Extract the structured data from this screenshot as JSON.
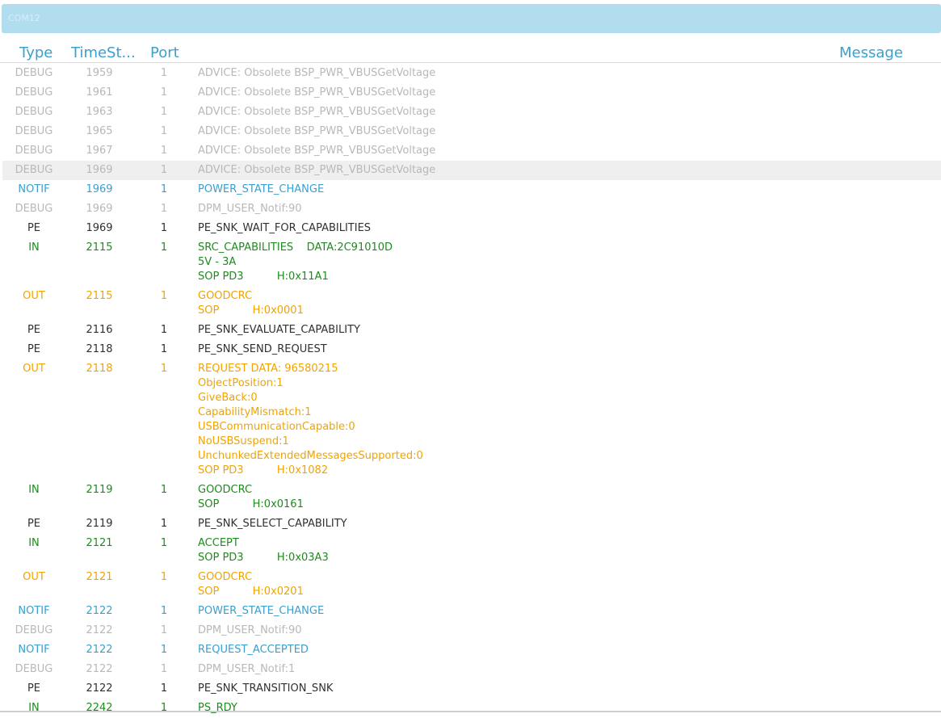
{
  "window": {
    "title": "COM12"
  },
  "columns": {
    "type": "Type",
    "timestamp": "TimeSt...",
    "port": "Port",
    "message": "Message"
  },
  "colors": {
    "DEBUG": "#b8b8b8",
    "NOTIF": "#3a9fcf",
    "PE": "#303030",
    "IN": "#1e8b1e",
    "OUT": "#f0a400"
  },
  "rows": [
    {
      "type": "DEBUG",
      "time": "1959",
      "port": "1",
      "message": [
        "ADVICE: Obsolete BSP_PWR_VBUSGetVoltage"
      ]
    },
    {
      "type": "DEBUG",
      "time": "1961",
      "port": "1",
      "message": [
        "ADVICE: Obsolete BSP_PWR_VBUSGetVoltage"
      ]
    },
    {
      "type": "DEBUG",
      "time": "1963",
      "port": "1",
      "message": [
        "ADVICE: Obsolete BSP_PWR_VBUSGetVoltage"
      ]
    },
    {
      "type": "DEBUG",
      "time": "1965",
      "port": "1",
      "message": [
        "ADVICE: Obsolete BSP_PWR_VBUSGetVoltage"
      ]
    },
    {
      "type": "DEBUG",
      "time": "1967",
      "port": "1",
      "message": [
        "ADVICE: Obsolete BSP_PWR_VBUSGetVoltage"
      ]
    },
    {
      "type": "DEBUG",
      "time": "1969",
      "port": "1",
      "message": [
        "ADVICE: Obsolete BSP_PWR_VBUSGetVoltage"
      ],
      "selected": true
    },
    {
      "type": "NOTIF",
      "time": "1969",
      "port": "1",
      "message": [
        "POWER_STATE_CHANGE"
      ]
    },
    {
      "type": "DEBUG",
      "time": "1969",
      "port": "1",
      "message": [
        "DPM_USER_Notif:90"
      ]
    },
    {
      "type": "PE",
      "time": "1969",
      "port": "1",
      "message": [
        "PE_SNK_WAIT_FOR_CAPABILITIES"
      ]
    },
    {
      "type": "IN",
      "time": "2115",
      "port": "1",
      "message": [
        "SRC_CAPABILITIES    DATA:2C91010D",
        "5V - 3A",
        "SOP PD3          H:0x11A1"
      ]
    },
    {
      "type": "OUT",
      "time": "2115",
      "port": "1",
      "message": [
        "GOODCRC",
        "SOP          H:0x0001"
      ]
    },
    {
      "type": "PE",
      "time": "2116",
      "port": "1",
      "message": [
        "PE_SNK_EVALUATE_CAPABILITY"
      ]
    },
    {
      "type": "PE",
      "time": "2118",
      "port": "1",
      "message": [
        "PE_SNK_SEND_REQUEST"
      ]
    },
    {
      "type": "OUT",
      "time": "2118",
      "port": "1",
      "message": [
        "REQUEST DATA: 96580215",
        "ObjectPosition:1",
        "GiveBack:0",
        "CapabilityMismatch:1",
        "USBCommunicationCapable:0",
        "NoUSBSuspend:1",
        "UnchunkedExtendedMessagesSupported:0",
        "SOP PD3          H:0x1082"
      ]
    },
    {
      "type": "IN",
      "time": "2119",
      "port": "1",
      "message": [
        "GOODCRC",
        "SOP          H:0x0161"
      ]
    },
    {
      "type": "PE",
      "time": "2119",
      "port": "1",
      "message": [
        "PE_SNK_SELECT_CAPABILITY"
      ]
    },
    {
      "type": "IN",
      "time": "2121",
      "port": "1",
      "message": [
        "ACCEPT",
        "SOP PD3          H:0x03A3"
      ]
    },
    {
      "type": "OUT",
      "time": "2121",
      "port": "1",
      "message": [
        "GOODCRC",
        "SOP          H:0x0201"
      ]
    },
    {
      "type": "NOTIF",
      "time": "2122",
      "port": "1",
      "message": [
        "POWER_STATE_CHANGE"
      ]
    },
    {
      "type": "DEBUG",
      "time": "2122",
      "port": "1",
      "message": [
        "DPM_USER_Notif:90"
      ]
    },
    {
      "type": "NOTIF",
      "time": "2122",
      "port": "1",
      "message": [
        "REQUEST_ACCEPTED"
      ]
    },
    {
      "type": "DEBUG",
      "time": "2122",
      "port": "1",
      "message": [
        "DPM_USER_Notif:1"
      ]
    },
    {
      "type": "PE",
      "time": "2122",
      "port": "1",
      "message": [
        "PE_SNK_TRANSITION_SNK"
      ]
    },
    {
      "type": "IN",
      "time": "2242",
      "port": "1",
      "message": [
        "PS_RDY"
      ]
    }
  ]
}
